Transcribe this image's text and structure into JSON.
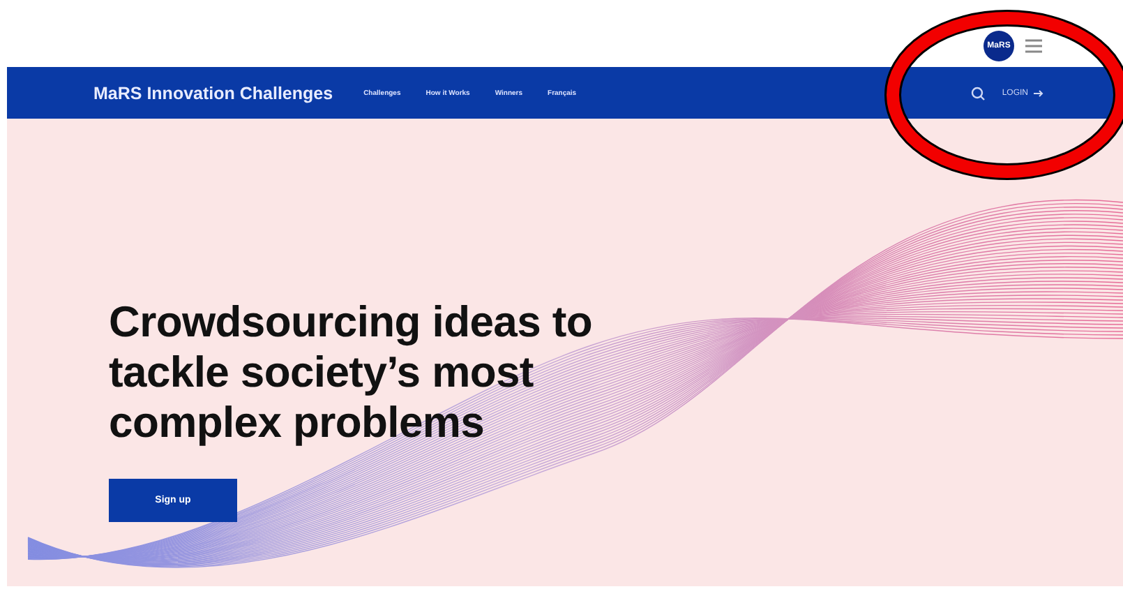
{
  "top_bar": {
    "logo": "MaRS"
  },
  "nav": {
    "brand": "MaRS Innovation Challenges",
    "links": [
      "Challenges",
      "How it Works",
      "Winners",
      "Français"
    ],
    "login": "LOGIN"
  },
  "hero": {
    "heading": "Crowdsourcing ideas to tackle society’s most complex problems",
    "button": "Sign up"
  }
}
